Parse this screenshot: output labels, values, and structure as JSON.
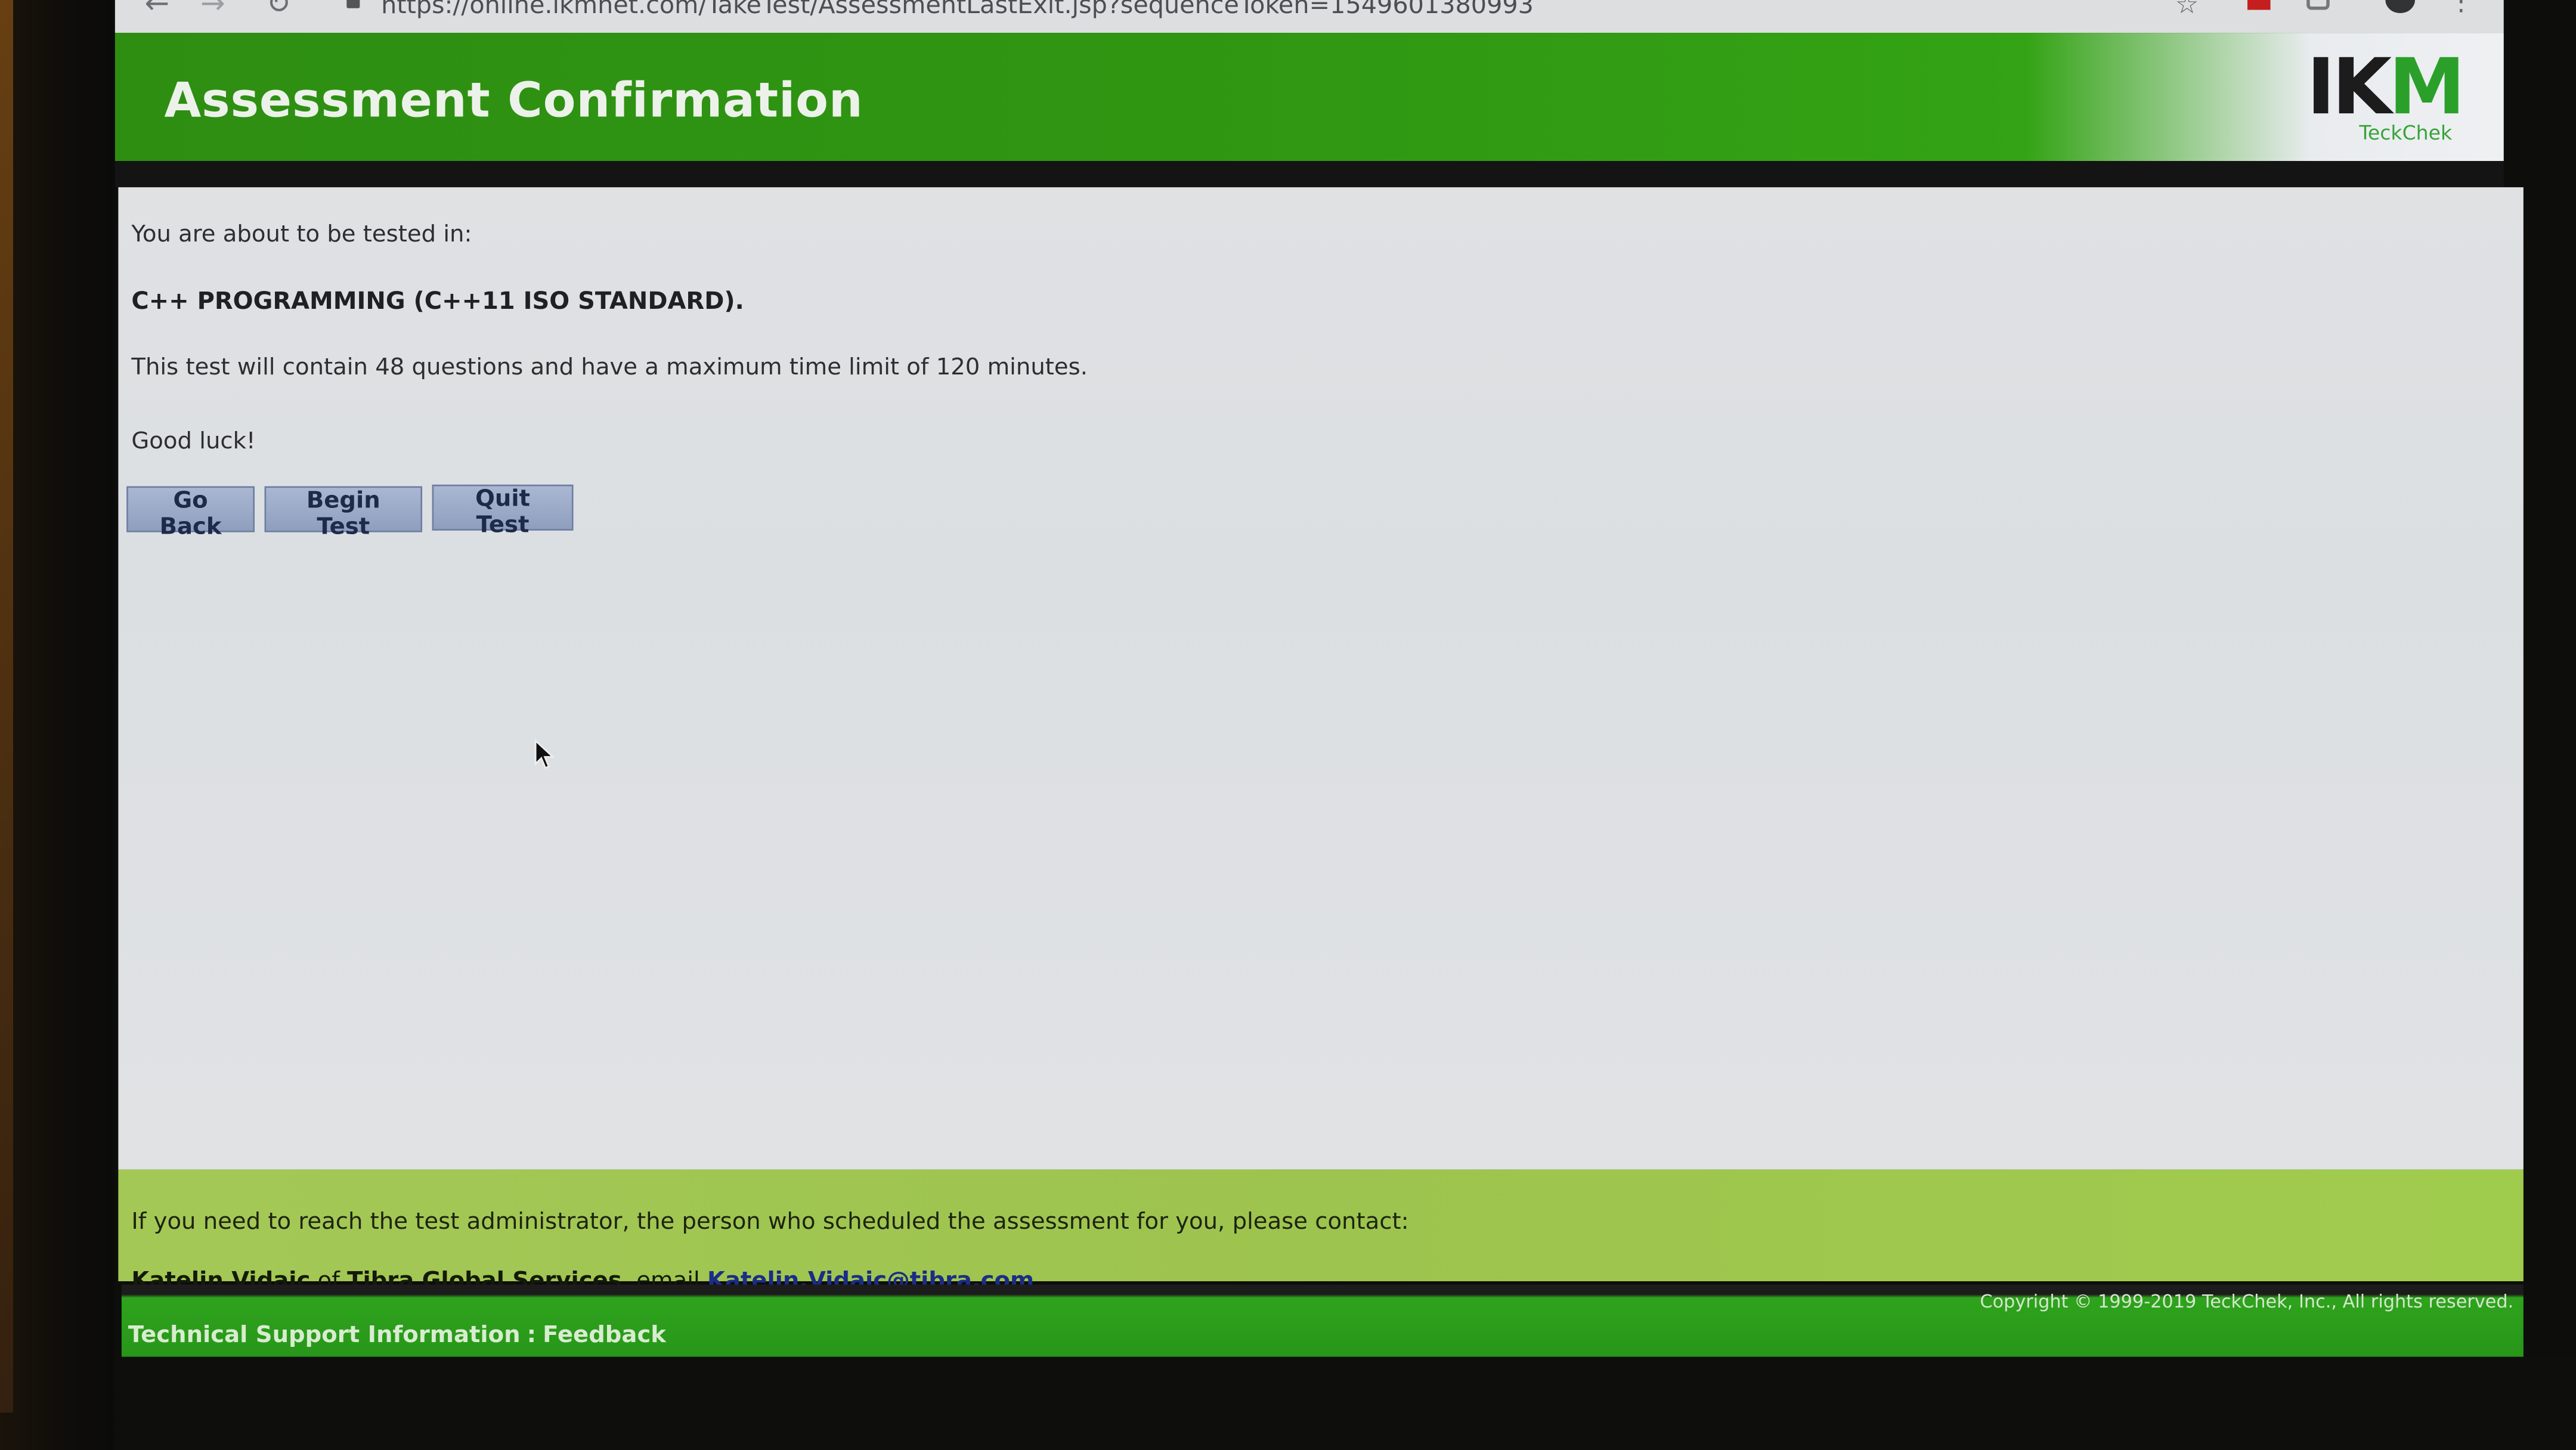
{
  "browser": {
    "url": "https://online.ikmnet.com/TakeTest/AssessmentLastExit.jsp?sequenceToken=1549601380993"
  },
  "header": {
    "title": "Assessment Confirmation",
    "logo_mark": "IKM",
    "logo_sub": "TeckChek"
  },
  "main": {
    "intro": "You are about to be tested in:",
    "course": "C++ PROGRAMMING (C++11 ISO STANDARD).",
    "details": "This test will contain 48 questions and have a maximum time limit of 120 minutes.",
    "good_luck": "Good luck!",
    "buttons": {
      "go_back": "Go Back",
      "begin_test": "Begin Test",
      "quit_test": "Quit Test"
    }
  },
  "contact": {
    "line1": "If you need to reach the test administrator, the person who scheduled the assessment for you, please contact:",
    "name": "Katelin Vidaic",
    "of": "of",
    "company": "Tibra Global Services",
    "email_label": ", email",
    "email": "Katelin.Vidaic@tibra.com"
  },
  "footer": {
    "support_link": "Technical Support Information",
    "separator": ":",
    "feedback_link": "Feedback",
    "copyright": "Copyright © 1999-2019 TeckChek, Inc., All rights reserved."
  },
  "colors": {
    "header_green": "#2f9612",
    "contact_bg": "#a0c850",
    "button_bg": "#9eadc9",
    "link_blue": "#1b2d86"
  }
}
